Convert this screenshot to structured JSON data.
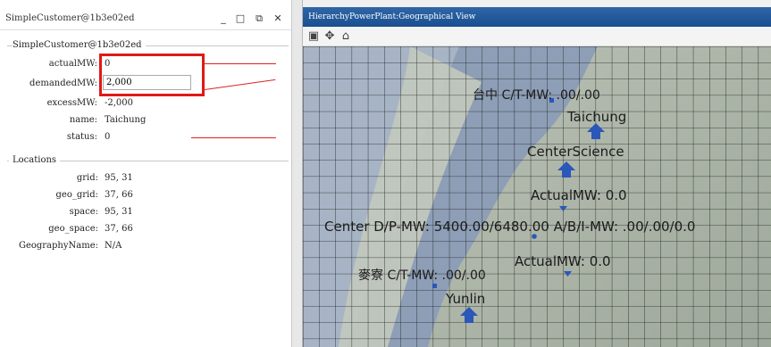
{
  "left_panel": {
    "title": "SimpleCustomer@1b3e02ed",
    "controls": {
      "minimize": "_",
      "maximize": "□",
      "restore": "⧉",
      "close": "✕"
    },
    "section_header": "SimpleCustomer@1b3e02ed",
    "fields": {
      "actualMW": {
        "label": "actualMW:",
        "value": "0"
      },
      "demandedMW": {
        "label": "demandedMW:",
        "value": "2,000"
      },
      "excessMW": {
        "label": "excessMW:",
        "value": "-2,000"
      },
      "name": {
        "label": "name:",
        "value": "Taichung"
      },
      "status": {
        "label": "status:",
        "value": "0"
      }
    },
    "locations": {
      "header": "Locations",
      "grid": {
        "label": "grid:",
        "value": "95, 31"
      },
      "geo_grid": {
        "label": "geo_grid:",
        "value": "37, 66"
      },
      "space": {
        "label": "space:",
        "value": "95, 31"
      },
      "geo_space": {
        "label": "geo_space:",
        "value": "37, 66"
      },
      "GeographyName": {
        "label": "GeographyName:",
        "value": "N/A"
      }
    },
    "highlight_color": "#e01818"
  },
  "map_panel": {
    "title": "HierarchyPowerPlant:Geographical View",
    "toolbar_icons": [
      "image-icon",
      "pan-icon",
      "home-icon"
    ],
    "title_color": "#1a4f91",
    "labels": {
      "taichung_ct": "台中 C/T-MW: .00/.00",
      "taichung": "Taichung",
      "center_science": "CenterScience",
      "actual_mw_1": "ActualMW: 0.0",
      "center_dp": "Center D/P-MW: 5400.00/6480.00 A/B/I-MW: .00/.00/0.0",
      "actual_mw_2": "ActualMW: 0.0",
      "mailiao_ct": "麥寮 C/T-MW: .00/.00",
      "yunlin": "Yunlin"
    },
    "marker_color": "#2a57b8"
  }
}
